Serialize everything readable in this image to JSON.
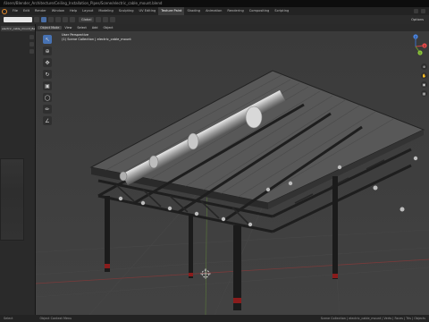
{
  "titlebar": {
    "text": "/Users/Blender_Architecture/Ceiling_Installation_Pipes/Scene/electric_cable_mount.blend"
  },
  "menubar": {
    "tabs": [
      "File",
      "Edit",
      "Render",
      "Window",
      "Help",
      "Layout",
      "Modeling",
      "Sculpting",
      "UV Editing",
      "Texture Paint",
      "Shading",
      "Animation",
      "Rendering",
      "Compositing",
      "Scripting"
    ],
    "active_tab": "Texture Paint"
  },
  "toolheader": {
    "orientation": "Global",
    "options": "Options"
  },
  "left_panel": {
    "path_label": "electric_cable_mount_BaseColor"
  },
  "viewport": {
    "header_items": [
      "Object Mode",
      "View",
      "Select",
      "Add",
      "Object"
    ],
    "view_label": "User Perspective",
    "collection_label": "(1) Scene Collection | electric_cable_mount"
  },
  "gizmo": {
    "x_label": "X",
    "y_label": "Y",
    "z_label": "Z"
  },
  "statusbar": {
    "left": "Select",
    "middle": "Object Context Menu",
    "right": "Scene Collection | electric_cable_mount | Verts | Faces | Tris | Objects"
  }
}
